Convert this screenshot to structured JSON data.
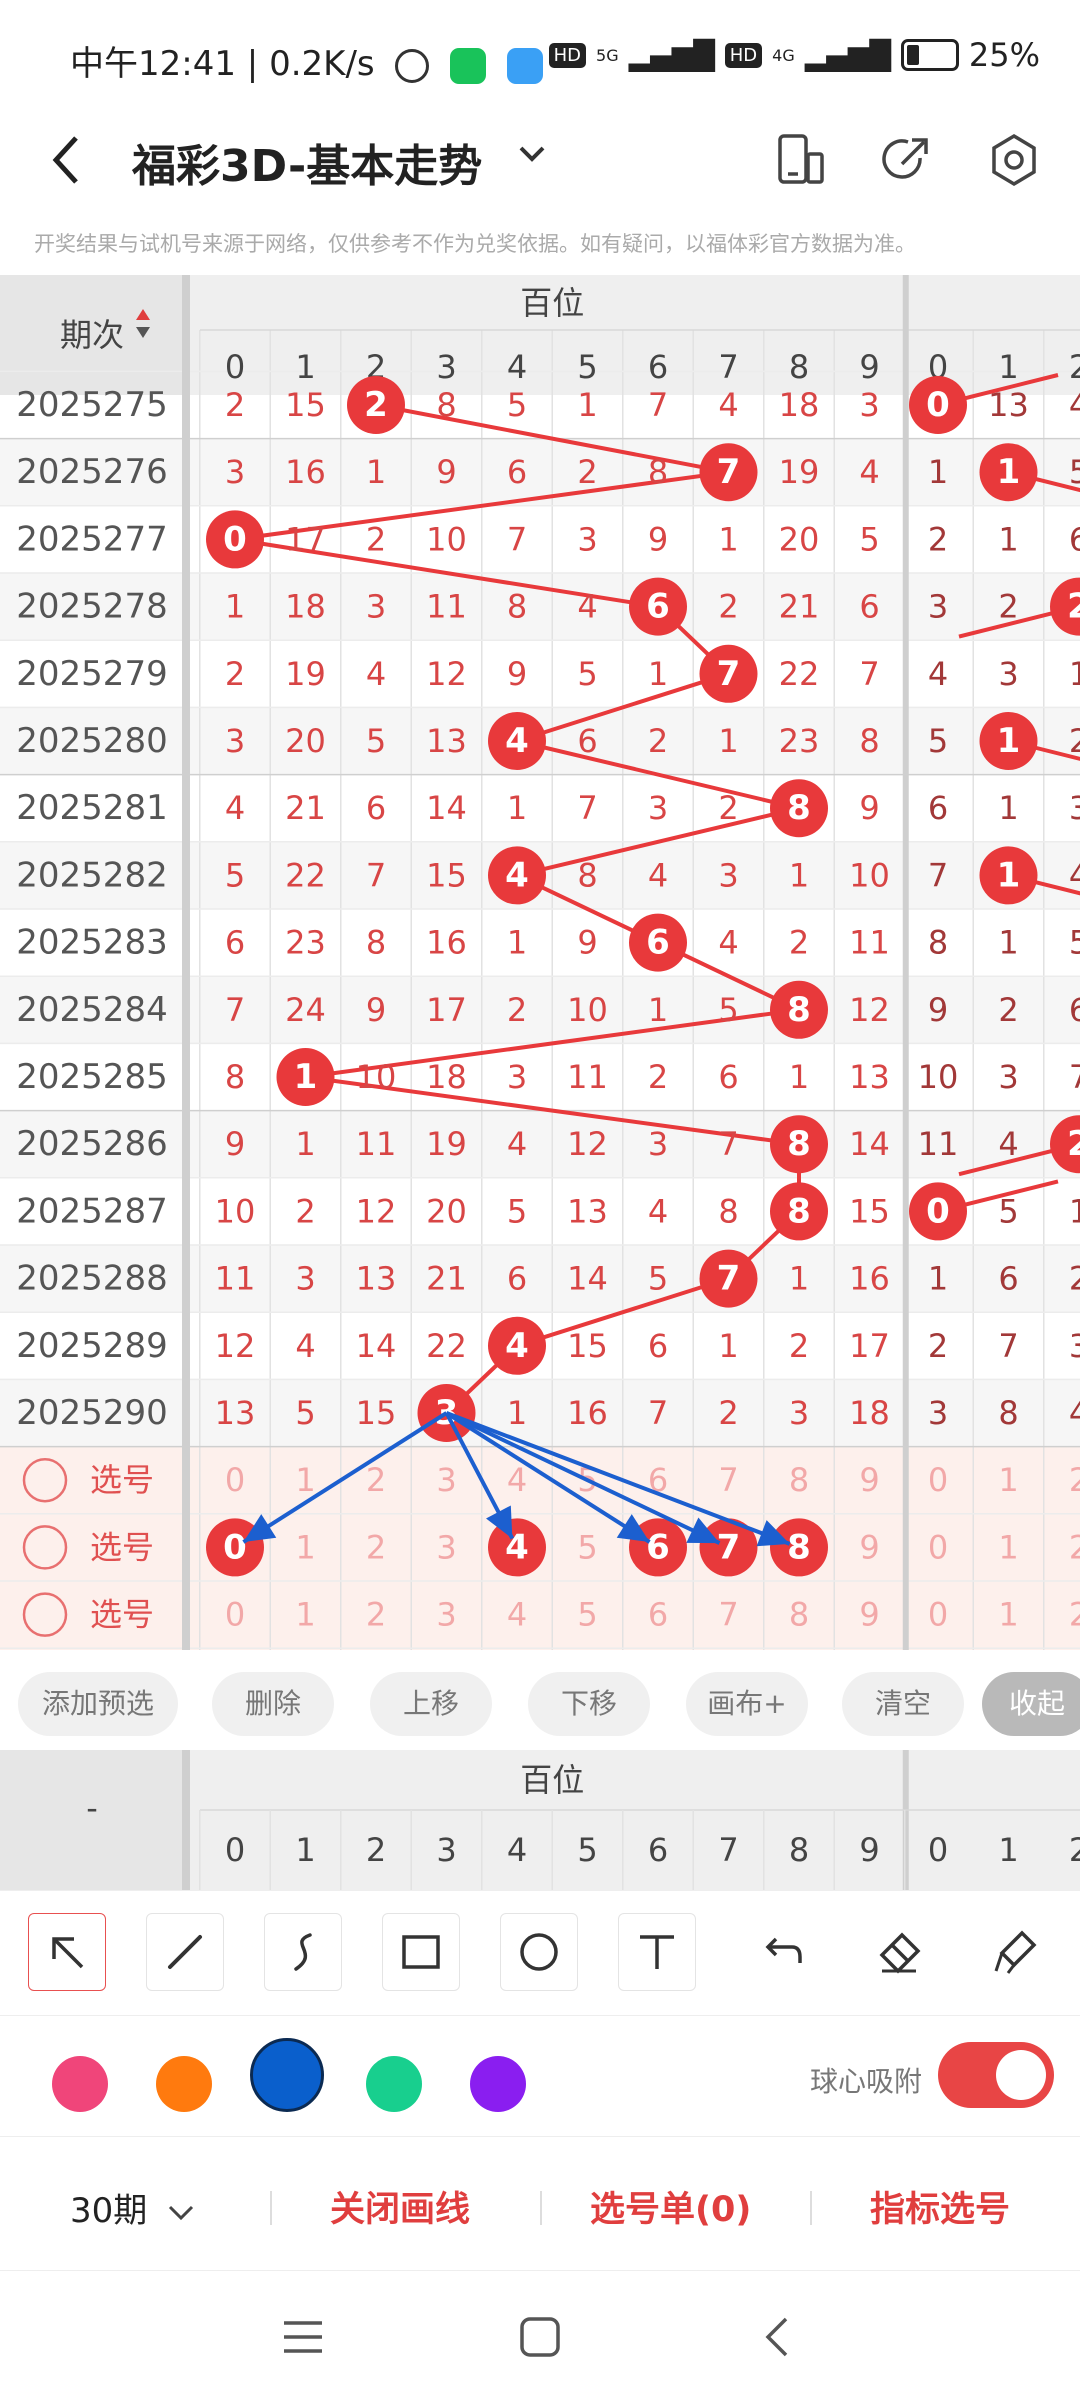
{
  "status_bar": {
    "time": "中午12:41",
    "speed": "0.2K/s",
    "sep": "|",
    "hd1": "HD",
    "net1": "5G",
    "hd2": "HD",
    "net2": "4G",
    "battery": "25%"
  },
  "titlebar": {
    "title": "福彩3D-基本走势",
    "back_icon": "chevron-left-icon",
    "dropdown_icon": "chevron-down-icon"
  },
  "notice": "开奖结果与试机号来源于网络，仅供参考不作为兑奖依据。如有疑问，以福体彩官方数据为准。",
  "table": {
    "period_header": "期次",
    "section_header": "百位",
    "digits_main": [
      "0",
      "1",
      "2",
      "3",
      "4",
      "5",
      "6",
      "7",
      "8",
      "9"
    ],
    "digits_next": [
      "0",
      "1",
      "2"
    ],
    "rows": [
      {
        "period": "2025275",
        "cells": [
          "2",
          "15",
          "2",
          "8",
          "5",
          "1",
          "7",
          "4",
          "18",
          "3"
        ],
        "next": [
          "0",
          "13",
          "4"
        ],
        "ball": 2,
        "next_ball": 0
      },
      {
        "period": "2025276",
        "cells": [
          "3",
          "16",
          "1",
          "9",
          "6",
          "2",
          "8",
          "7",
          "19",
          "4"
        ],
        "next": [
          "1",
          "1",
          "5"
        ],
        "ball": 7,
        "next_ball": 1
      },
      {
        "period": "2025277",
        "cells": [
          "0",
          "17",
          "2",
          "10",
          "7",
          "3",
          "9",
          "1",
          "20",
          "5"
        ],
        "next": [
          "2",
          "1",
          "6"
        ],
        "ball": 0,
        "next_ball": -1
      },
      {
        "period": "2025278",
        "cells": [
          "1",
          "18",
          "3",
          "11",
          "8",
          "4",
          "6",
          "2",
          "21",
          "6"
        ],
        "next": [
          "3",
          "2",
          "2"
        ],
        "ball": 6,
        "next_ball": 2
      },
      {
        "period": "2025279",
        "cells": [
          "2",
          "19",
          "4",
          "12",
          "9",
          "5",
          "1",
          "7",
          "22",
          "7"
        ],
        "next": [
          "4",
          "3",
          "1"
        ],
        "ball": 7,
        "next_ball": -1
      },
      {
        "period": "2025280",
        "cells": [
          "3",
          "20",
          "5",
          "13",
          "4",
          "6",
          "2",
          "1",
          "23",
          "8"
        ],
        "next": [
          "5",
          "1",
          "2"
        ],
        "ball": 4,
        "next_ball": 1
      },
      {
        "period": "2025281",
        "cells": [
          "4",
          "21",
          "6",
          "14",
          "1",
          "7",
          "3",
          "2",
          "8",
          "9"
        ],
        "next": [
          "6",
          "1",
          "3"
        ],
        "ball": 8,
        "next_ball": -1
      },
      {
        "period": "2025282",
        "cells": [
          "5",
          "22",
          "7",
          "15",
          "4",
          "8",
          "4",
          "3",
          "1",
          "10"
        ],
        "next": [
          "7",
          "1",
          "4"
        ],
        "ball": 4,
        "next_ball": 1
      },
      {
        "period": "2025283",
        "cells": [
          "6",
          "23",
          "8",
          "16",
          "1",
          "9",
          "6",
          "4",
          "2",
          "11"
        ],
        "next": [
          "8",
          "1",
          "5"
        ],
        "ball": 6,
        "next_ball": -1
      },
      {
        "period": "2025284",
        "cells": [
          "7",
          "24",
          "9",
          "17",
          "2",
          "10",
          "1",
          "5",
          "8",
          "12"
        ],
        "next": [
          "9",
          "2",
          "6"
        ],
        "ball": 8,
        "next_ball": -1
      },
      {
        "period": "2025285",
        "cells": [
          "8",
          "1",
          "10",
          "18",
          "3",
          "11",
          "2",
          "6",
          "1",
          "13"
        ],
        "next": [
          "10",
          "3",
          "7"
        ],
        "ball": 1,
        "next_ball": -1
      },
      {
        "period": "2025286",
        "cells": [
          "9",
          "1",
          "11",
          "19",
          "4",
          "12",
          "3",
          "7",
          "8",
          "14"
        ],
        "next": [
          "11",
          "4",
          "2"
        ],
        "ball": 8,
        "next_ball": 2
      },
      {
        "period": "2025287",
        "cells": [
          "10",
          "2",
          "12",
          "20",
          "5",
          "13",
          "4",
          "8",
          "8",
          "15"
        ],
        "next": [
          "0",
          "5",
          "1"
        ],
        "ball": 8,
        "next_ball": 0
      },
      {
        "period": "2025288",
        "cells": [
          "11",
          "3",
          "13",
          "21",
          "6",
          "14",
          "5",
          "7",
          "1",
          "16"
        ],
        "next": [
          "1",
          "6",
          "2"
        ],
        "ball": 7,
        "next_ball": -1
      },
      {
        "period": "2025289",
        "cells": [
          "12",
          "4",
          "14",
          "22",
          "4",
          "15",
          "6",
          "1",
          "2",
          "17"
        ],
        "next": [
          "2",
          "7",
          "3"
        ],
        "ball": 4,
        "next_ball": -1
      },
      {
        "period": "2025290",
        "cells": [
          "13",
          "5",
          "15",
          "3",
          "1",
          "16",
          "7",
          "2",
          "3",
          "18"
        ],
        "next": [
          "3",
          "8",
          "4"
        ],
        "ball": 3,
        "next_ball": -1
      }
    ],
    "select_rows": [
      {
        "label": "选号",
        "balls": []
      },
      {
        "label": "选号",
        "balls": [
          0,
          4,
          6,
          7,
          8
        ]
      },
      {
        "label": "选号",
        "balls": []
      }
    ],
    "arrows_from": 3,
    "arrows_to": [
      0,
      4,
      6,
      7,
      8
    ]
  },
  "buttons": {
    "add_preselect": "添加预选",
    "delete": "删除",
    "move_up": "上移",
    "move_down": "下移",
    "canvas_plus": "画布+",
    "clear": "清空",
    "collapse": "收起"
  },
  "lower_table": {
    "left_label": "-",
    "section_header": "百位",
    "digits_main": [
      "0",
      "1",
      "2",
      "3",
      "4",
      "5",
      "6",
      "7",
      "8",
      "9"
    ],
    "digits_next": [
      "0",
      "1",
      "2"
    ]
  },
  "tools": {
    "items": [
      "pointer-arrow-icon",
      "line-icon",
      "curve-icon",
      "rectangle-icon",
      "circle-icon",
      "text-icon",
      "undo-icon",
      "eraser-icon",
      "clear-canvas-icon"
    ]
  },
  "colors": {
    "swatches": [
      "#f0457a",
      "#ff7a0e",
      "#0a5fcc",
      "#18cf8e",
      "#8a1ef0"
    ],
    "selected": "#0a5fcc",
    "ball_red": "#e8393b",
    "arrow_blue": "#1c5fcf"
  },
  "snap": {
    "label": "球心吸附",
    "enabled": true
  },
  "actions": {
    "periods": "30期",
    "close_lines": "关闭画线",
    "selection_list": "选号单(0)",
    "indicator_select": "指标选号"
  }
}
